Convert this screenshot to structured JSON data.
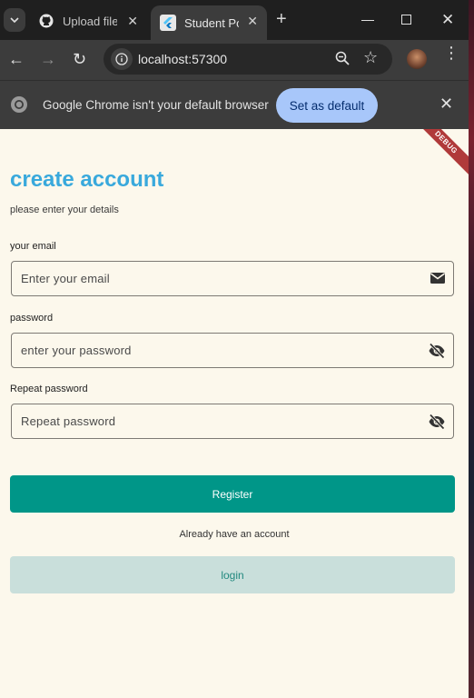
{
  "browser": {
    "tabs": [
      {
        "title": "Upload files",
        "icon": "github-icon",
        "active": false
      },
      {
        "title": "Student Portal",
        "icon": "flutter-icon",
        "active": true
      }
    ],
    "url": "localhost:57300",
    "infobar": {
      "message": "Google Chrome isn't your default browser",
      "button": "Set as default"
    }
  },
  "app": {
    "debug_banner": "DEBUG",
    "title": "create account",
    "subtitle": "please enter your details",
    "fields": [
      {
        "label": "your email",
        "placeholder": "Enter your email",
        "icon": "mail-icon"
      },
      {
        "label": "password",
        "placeholder": "enter your password",
        "icon": "visibility-off-icon"
      },
      {
        "label": "Repeat password",
        "placeholder": "Repeat password",
        "icon": "visibility-off-icon"
      }
    ],
    "register_label": "Register",
    "already_text": "Already have an account",
    "login_label": "login"
  },
  "colors": {
    "accent": "#39a9dc",
    "primary_button": "#009688",
    "secondary_button": "#c9dfdb",
    "page_background": "#fcf8ec"
  }
}
